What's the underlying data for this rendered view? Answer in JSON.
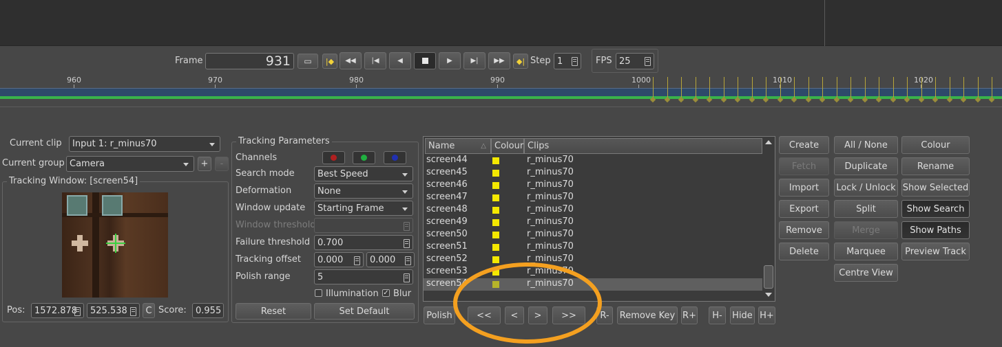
{
  "transport": {
    "frame_label": "Frame",
    "frame_value": "931",
    "step_label": "Step",
    "step_value": "1",
    "fps_label": "FPS",
    "fps_value": "25"
  },
  "timeline": {
    "ticks": [
      "960",
      "970",
      "980",
      "990",
      "1000",
      "1010",
      "1020"
    ]
  },
  "clip": {
    "current_clip_label": "Current clip",
    "current_clip_value": "Input 1: r_minus70",
    "current_group_label": "Current group",
    "current_group_value": "Camera",
    "add_label": "+",
    "remove_label": "-"
  },
  "tracking_window": {
    "title": "Tracking Window: [screen54]",
    "pos_label": "Pos:",
    "pos_x": "1572.878",
    "pos_y": "525.538",
    "c_label": "C",
    "score_label": "Score:",
    "score_value": "0.955"
  },
  "tracking_params": {
    "title": "Tracking Parameters",
    "channels_label": "Channels",
    "search_mode_label": "Search mode",
    "search_mode_value": "Best Speed",
    "deformation_label": "Deformation",
    "deformation_value": "None",
    "window_update_label": "Window update",
    "window_update_value": "Starting Frame",
    "window_threshold_label": "Window threshold",
    "failure_threshold_label": "Failure threshold",
    "failure_threshold_value": "0.700",
    "tracking_offset_label": "Tracking offset",
    "tracking_offset_x": "0.000",
    "tracking_offset_y": "0.000",
    "polish_range_label": "Polish range",
    "polish_range_value": "5",
    "illumination_label": "Illumination",
    "blur_label": "Blur",
    "reset_label": "Reset",
    "set_default_label": "Set Default"
  },
  "tracker_list": {
    "headers": [
      "Name",
      "Colour",
      "Clips"
    ],
    "rows": [
      {
        "name": "screen44",
        "clip": "r_minus70"
      },
      {
        "name": "screen45",
        "clip": "r_minus70"
      },
      {
        "name": "screen46",
        "clip": "r_minus70"
      },
      {
        "name": "screen47",
        "clip": "r_minus70"
      },
      {
        "name": "screen48",
        "clip": "r_minus70"
      },
      {
        "name": "screen49",
        "clip": "r_minus70"
      },
      {
        "name": "screen50",
        "clip": "r_minus70"
      },
      {
        "name": "screen51",
        "clip": "r_minus70"
      },
      {
        "name": "screen52",
        "clip": "r_minus70"
      },
      {
        "name": "screen53",
        "clip": "r_minus70"
      },
      {
        "name": "screen54",
        "clip": "r_minus70"
      }
    ],
    "swatch_color": "#f4e800"
  },
  "bottom_bar": {
    "polish": "Polish",
    "first": "<<",
    "prev": "<",
    "next": ">",
    "last": ">>",
    "r_minus": "R-",
    "remove_key": "Remove Key",
    "r_plus": "R+",
    "h_minus": "H-",
    "hide": "Hide",
    "h_plus": "H+"
  },
  "actions": {
    "create": "Create",
    "fetch": "Fetch",
    "import": "Import",
    "export": "Export",
    "remove": "Remove",
    "delete": "Delete",
    "all_none": "All / None",
    "duplicate": "Duplicate",
    "lock_unlock": "Lock / Unlock",
    "split": "Split",
    "merge": "Merge",
    "marquee": "Marquee",
    "centre_view": "Centre View",
    "colour": "Colour",
    "rename": "Rename",
    "show_selected": "Show Selected",
    "show_search": "Show Search",
    "show_paths": "Show Paths",
    "preview_track": "Preview Track"
  },
  "colors": {
    "annotation_circle": "#f4a020",
    "channel_red": "#b02020",
    "channel_green": "#20b040",
    "channel_blue": "#2030b0"
  }
}
